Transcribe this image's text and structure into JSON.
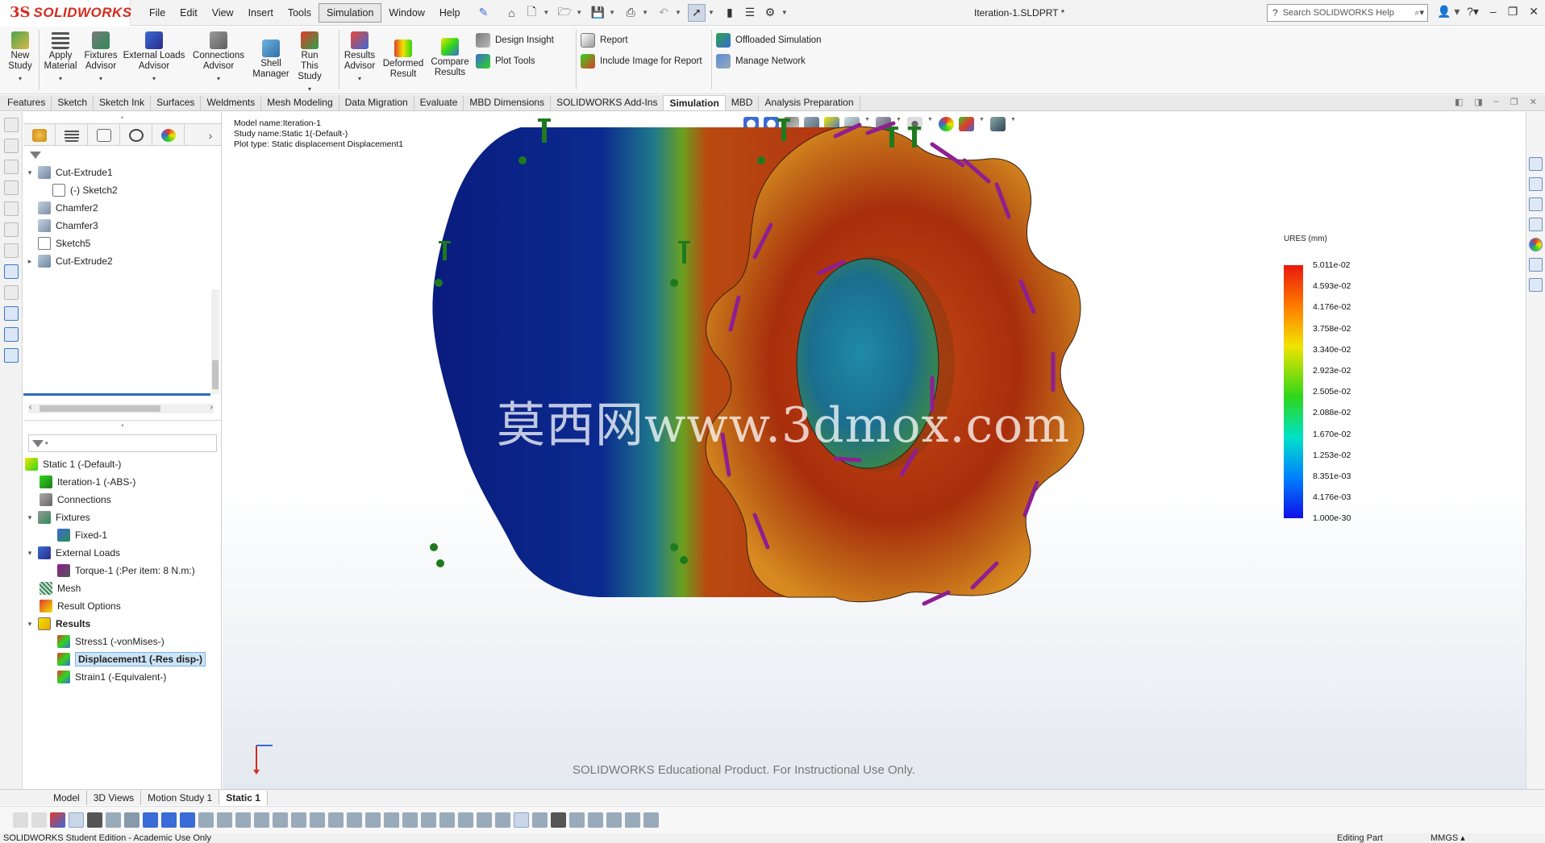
{
  "app": {
    "brand_mark": "3S",
    "brand_name": "SOLIDWORKS"
  },
  "menu": [
    "File",
    "Edit",
    "View",
    "Insert",
    "Tools",
    "Simulation",
    "Window",
    "Help"
  ],
  "menu_active": "Simulation",
  "document_title": "Iteration-1.SLDPRT *",
  "search": {
    "placeholder": "Search SOLIDWORKS Help"
  },
  "ribbon": {
    "new_study": "New Study",
    "apply_material": "Apply Material",
    "fixtures_advisor": "Fixtures Advisor",
    "external_loads_advisor": "External Loads Advisor",
    "connections_advisor": "Connections Advisor",
    "shell_manager": "Shell Manager",
    "run_this_study": "Run This Study",
    "results_advisor": "Results Advisor",
    "deformed_result": "Deformed Result",
    "compare_results": "Compare Results",
    "design_insight": "Design Insight",
    "plot_tools": "Plot Tools",
    "report": "Report",
    "include_image_for_report": "Include Image for Report",
    "offloaded_simulation": "Offloaded Simulation",
    "manage_network": "Manage Network"
  },
  "tabs": [
    "Features",
    "Sketch",
    "Sketch Ink",
    "Surfaces",
    "Weldments",
    "Mesh Modeling",
    "Data Migration",
    "Evaluate",
    "MBD Dimensions",
    "SOLIDWORKS Add-Ins",
    "Simulation",
    "MBD",
    "Analysis Preparation"
  ],
  "active_tab": "Simulation",
  "feature_tree": {
    "items": [
      {
        "label": "Cut-Extrude1"
      },
      {
        "label": "(-) Sketch2"
      },
      {
        "label": "Chamfer2"
      },
      {
        "label": "Chamfer3"
      },
      {
        "label": "Sketch5"
      },
      {
        "label": "Cut-Extrude2"
      }
    ]
  },
  "sim_tree": {
    "items": [
      {
        "label": "Static 1 (-Default-)"
      },
      {
        "label": "Iteration-1 (-ABS-)"
      },
      {
        "label": "Connections"
      },
      {
        "label": "Fixtures"
      },
      {
        "label": "Fixed-1"
      },
      {
        "label": "External Loads"
      },
      {
        "label": "Torque-1 (:Per item: 8 N.m:)"
      },
      {
        "label": "Mesh"
      },
      {
        "label": "Result Options"
      },
      {
        "label": "Results"
      },
      {
        "label": "Stress1 (-vonMises-)"
      },
      {
        "label": "Displacement1 (-Res disp-)"
      },
      {
        "label": "Strain1 (-Equivalent-)"
      }
    ],
    "selected": "Displacement1 (-Res disp-)"
  },
  "viewport": {
    "model_info": [
      "Model name:Iteration-1",
      "Study name:Static 1(-Default-)",
      "Plot type: Static displacement Displacement1"
    ],
    "watermark": "莫西网www.3dmox.com",
    "edu_notice": "SOLIDWORKS Educational Product. For Instructional Use Only."
  },
  "legend": {
    "title": "URES (mm)",
    "values": [
      "5.011e-02",
      "4.593e-02",
      "4.176e-02",
      "3.758e-02",
      "3.340e-02",
      "2.923e-02",
      "2.505e-02",
      "2.088e-02",
      "1.670e-02",
      "1.253e-02",
      "8.351e-03",
      "4.176e-03",
      "1.000e-30"
    ],
    "colors": [
      "#e8180c",
      "#ff7a00",
      "#f0e400",
      "#2fd61a",
      "#00e2c8",
      "#0080ff",
      "#1010e6"
    ]
  },
  "bottom_tabs": [
    "Model",
    "3D Views",
    "Motion Study 1",
    "Static 1"
  ],
  "active_bottom_tab": "Static 1",
  "status": {
    "left": "SOLIDWORKS Student Edition - Academic Use Only",
    "mode": "Editing Part",
    "units": "MMGS"
  },
  "accent_colors": {
    "brand_red": "#d52b1e",
    "selection_blue": "#cce4f7",
    "load_arrow_purple": "#8e1f91",
    "fixture_green": "#1f7a1f"
  }
}
